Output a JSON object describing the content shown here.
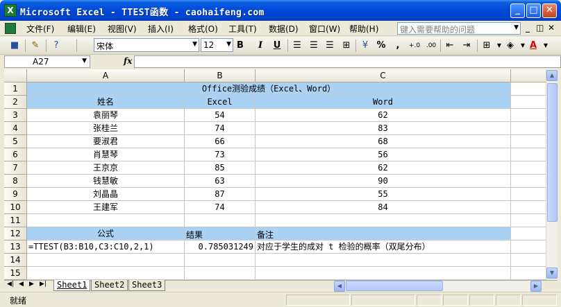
{
  "window": {
    "title": "Microsoft Excel - TTEST函数 - caohaifeng.com",
    "app_icon": "X",
    "minimize": "_",
    "maximize": "□",
    "close": "✕"
  },
  "menu": {
    "items": [
      "文件(F)",
      "编辑(E)",
      "视图(V)",
      "插入(I)",
      "格式(O)",
      "工具(T)",
      "数据(D)",
      "窗口(W)",
      "帮助(H)"
    ],
    "help_placeholder": "键入需要帮助的问题",
    "mdi_minimize": "_",
    "mdi_restore": "◫",
    "mdi_close": "✕"
  },
  "toolbar": {
    "font_name": "宋体",
    "font_size": "12",
    "bold": "B",
    "italic": "I",
    "underline": "U",
    "currency": "¥",
    "percent": "%",
    "comma": ",",
    "inc_decimal": "+.0",
    "dec_decimal": ".00",
    "font_color_letter": "A",
    "font_color": "#e00000"
  },
  "formula_bar": {
    "name_box": "A27",
    "fx_label": "fx",
    "formula": ""
  },
  "grid": {
    "columns": [
      "A",
      "B",
      "C"
    ],
    "rows": [
      "1",
      "2",
      "3",
      "4",
      "5",
      "6",
      "7",
      "8",
      "9",
      "10",
      "11",
      "12",
      "13",
      "14",
      "15"
    ],
    "selected_row": "27",
    "title": "Office测验成绩（Excel、Word）",
    "headers": [
      "姓名",
      "Excel",
      "Word"
    ],
    "data": [
      [
        "袁丽琴",
        "54",
        "62"
      ],
      [
        "张桂兰",
        "74",
        "83"
      ],
      [
        "要淑君",
        "66",
        "68"
      ],
      [
        "肖慧琴",
        "73",
        "56"
      ],
      [
        "王京京",
        "85",
        "62"
      ],
      [
        "钱慧敏",
        "63",
        "90"
      ],
      [
        "刘晶晶",
        "87",
        "55"
      ],
      [
        "王建军",
        "74",
        "84"
      ]
    ],
    "row12": [
      "公式",
      "结果",
      "备注"
    ],
    "row13": [
      "=TTEST(B3:B10,C3:C10,2,1)",
      "0.785031249",
      "对应于学生的成对 t 检验的概率（双尾分布）"
    ],
    "header_fill": "#aad2f4"
  },
  "sheets": {
    "tabs": [
      "Sheet1",
      "Sheet2",
      "Sheet3"
    ],
    "active": "Sheet1"
  },
  "status": {
    "text": "就绪"
  }
}
